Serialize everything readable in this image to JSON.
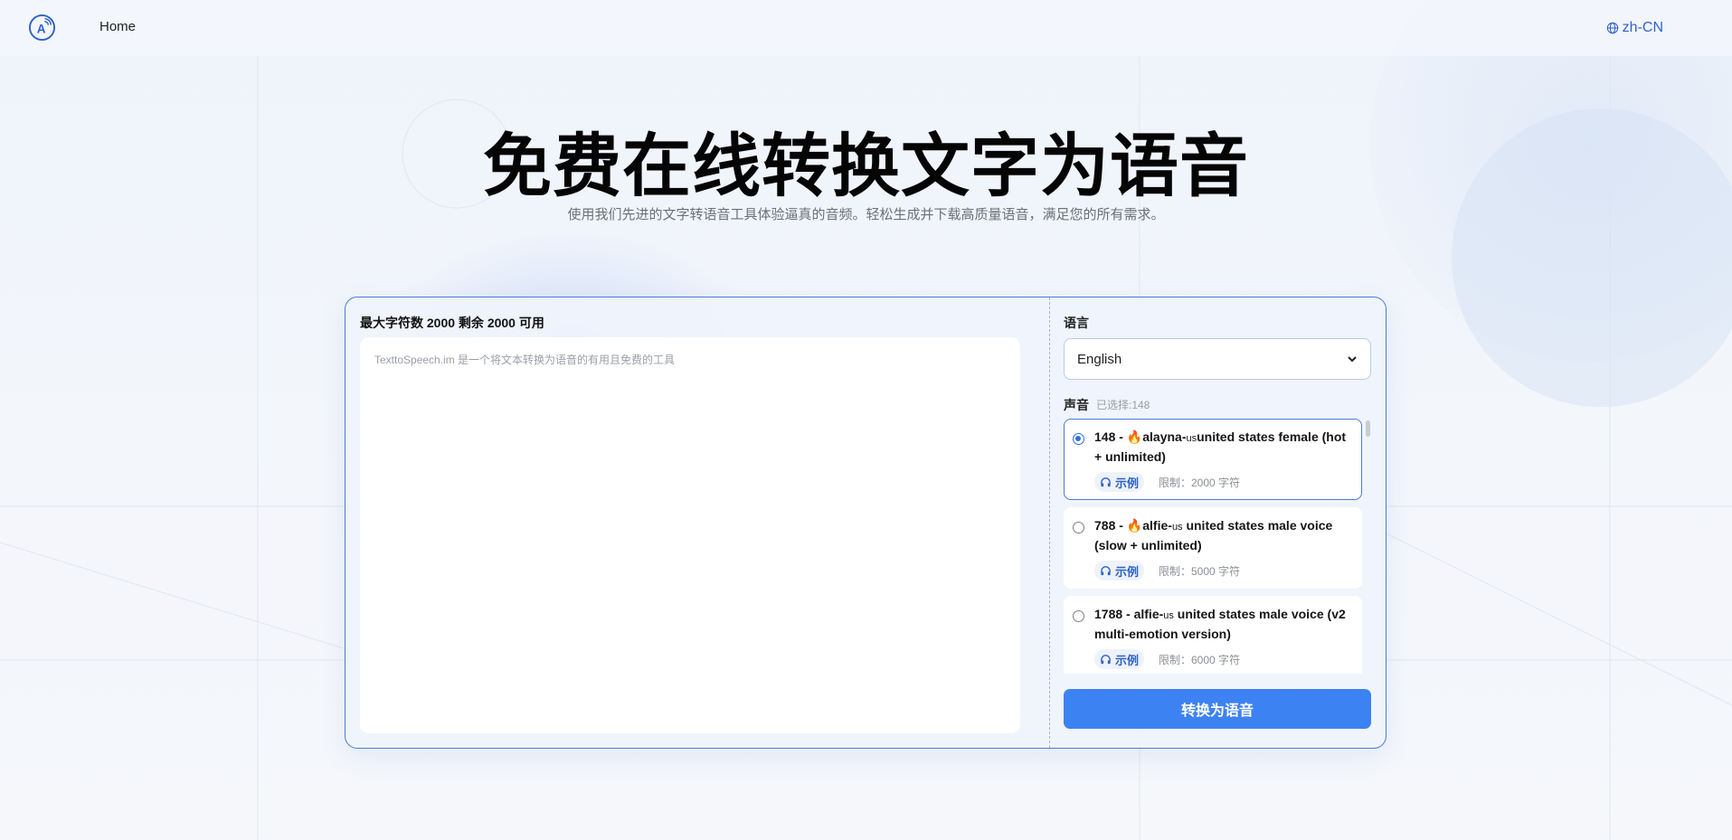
{
  "header": {
    "nav_home": "Home",
    "language_switch": "zh-CN"
  },
  "hero": {
    "title": "免费在线转换文字为语音",
    "subtitle": "使用我们先进的文字转语音工具体验逼真的音频。轻松生成并下载高质量语音，满足您的所有需求。"
  },
  "editor": {
    "char_info": "最大字符数 2000 剩余 2000 可用",
    "placeholder": "TexttoSpeech.im 是一个将文本转换为语音的有用且免费的工具"
  },
  "settings": {
    "language_label": "语言",
    "language_value": "English",
    "voice_label": "声音",
    "voice_selected": "已选择:148",
    "voices": [
      {
        "selected": true,
        "id_prefix": "148 - ",
        "emoji": "🔥",
        "name_main": "alayna-",
        "name_small": "us",
        "name_rest": "united states female (hot + unlimited)",
        "sample_label": "示例",
        "limit": "限制：2000 字符"
      },
      {
        "selected": false,
        "id_prefix": "788 - ",
        "emoji": "🔥",
        "name_main": "alfie-",
        "name_small": "us",
        "name_rest": " united states male voice (slow + unlimited)",
        "sample_label": "示例",
        "limit": "限制：5000 字符"
      },
      {
        "selected": false,
        "id_prefix": "1788 - ",
        "emoji": "",
        "name_main": "alfie-",
        "name_small": "us",
        "name_rest": " united states male voice (v2 multi-emotion version)",
        "sample_label": "示例",
        "limit": "限制：6000 字符"
      }
    ],
    "convert_button": "转换为语音"
  },
  "colors": {
    "accent": "#3d82f2",
    "link": "#2d62c9",
    "panel_border": "#4a7bd8"
  }
}
